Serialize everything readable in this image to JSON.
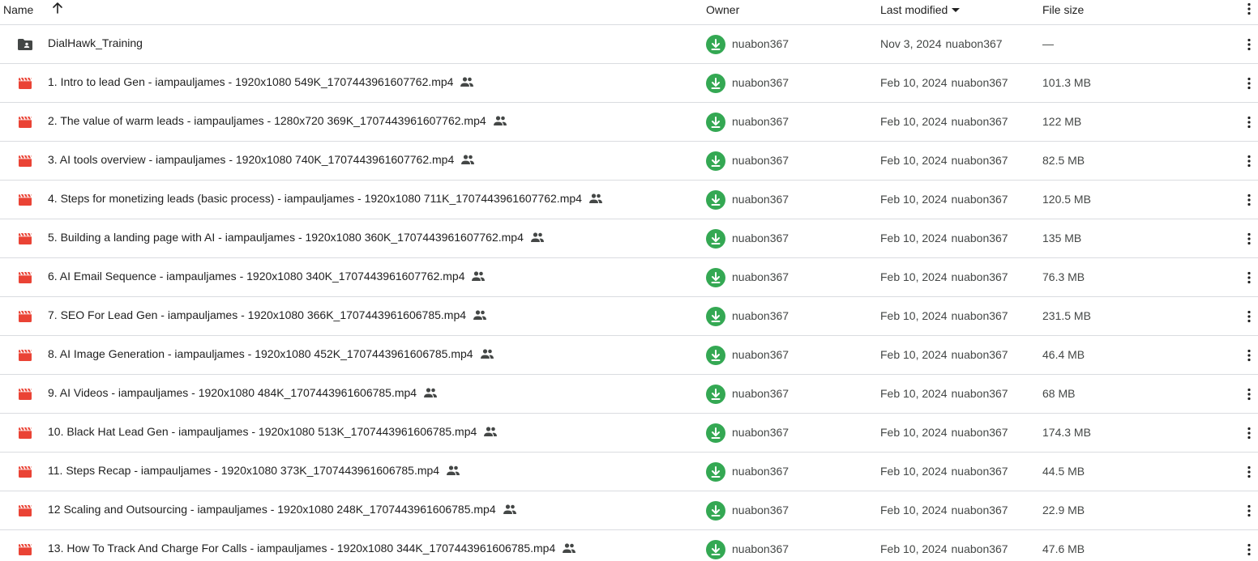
{
  "header": {
    "name_label": "Name",
    "owner_label": "Owner",
    "last_modified_label": "Last modified",
    "file_size_label": "File size"
  },
  "colors": {
    "folder_icon": "#444746",
    "video_icon": "#ea4335",
    "owner_avatar": "#34a853",
    "divider": "#dadce0"
  },
  "files": [
    {
      "type": "folder",
      "icon": "shared-folder-icon",
      "name": "DialHawk_Training",
      "shared": false,
      "owner": "nuabon367",
      "modified_date": "Nov 3, 2024",
      "modified_by": "nuabon367",
      "size": "—"
    },
    {
      "type": "video",
      "icon": "video-file-icon",
      "name": "1. Intro to lead Gen - iampauljames - 1920x1080 549K_1707443961607762.mp4",
      "shared": true,
      "owner": "nuabon367",
      "modified_date": "Feb 10, 2024",
      "modified_by": "nuabon367",
      "size": "101.3 MB"
    },
    {
      "type": "video",
      "icon": "video-file-icon",
      "name": "2. The value of warm leads - iampauljames - 1280x720 369K_1707443961607762.mp4",
      "shared": true,
      "owner": "nuabon367",
      "modified_date": "Feb 10, 2024",
      "modified_by": "nuabon367",
      "size": "122 MB"
    },
    {
      "type": "video",
      "icon": "video-file-icon",
      "name": "3. AI tools overview - iampauljames - 1920x1080 740K_1707443961607762.mp4",
      "shared": true,
      "owner": "nuabon367",
      "modified_date": "Feb 10, 2024",
      "modified_by": "nuabon367",
      "size": "82.5 MB"
    },
    {
      "type": "video",
      "icon": "video-file-icon",
      "name": "4. Steps for monetizing leads (basic process) - iampauljames - 1920x1080 711K_1707443961607762.mp4",
      "shared": true,
      "owner": "nuabon367",
      "modified_date": "Feb 10, 2024",
      "modified_by": "nuabon367",
      "size": "120.5 MB"
    },
    {
      "type": "video",
      "icon": "video-file-icon",
      "name": "5. Building a landing page with AI - iampauljames - 1920x1080 360K_1707443961607762.mp4",
      "shared": true,
      "owner": "nuabon367",
      "modified_date": "Feb 10, 2024",
      "modified_by": "nuabon367",
      "size": "135 MB"
    },
    {
      "type": "video",
      "icon": "video-file-icon",
      "name": "6. AI Email Sequence - iampauljames - 1920x1080 340K_1707443961607762.mp4",
      "shared": true,
      "owner": "nuabon367",
      "modified_date": "Feb 10, 2024",
      "modified_by": "nuabon367",
      "size": "76.3 MB"
    },
    {
      "type": "video",
      "icon": "video-file-icon",
      "name": "7. SEO For Lead Gen - iampauljames - 1920x1080 366K_1707443961606785.mp4",
      "shared": true,
      "owner": "nuabon367",
      "modified_date": "Feb 10, 2024",
      "modified_by": "nuabon367",
      "size": "231.5 MB"
    },
    {
      "type": "video",
      "icon": "video-file-icon",
      "name": "8. AI Image Generation - iampauljames - 1920x1080 452K_1707443961606785.mp4",
      "shared": true,
      "owner": "nuabon367",
      "modified_date": "Feb 10, 2024",
      "modified_by": "nuabon367",
      "size": "46.4 MB"
    },
    {
      "type": "video",
      "icon": "video-file-icon",
      "name": "9. AI Videos - iampauljames - 1920x1080 484K_1707443961606785.mp4",
      "shared": true,
      "owner": "nuabon367",
      "modified_date": "Feb 10, 2024",
      "modified_by": "nuabon367",
      "size": "68 MB"
    },
    {
      "type": "video",
      "icon": "video-file-icon",
      "name": "10. Black Hat Lead Gen - iampauljames - 1920x1080 513K_1707443961606785.mp4",
      "shared": true,
      "owner": "nuabon367",
      "modified_date": "Feb 10, 2024",
      "modified_by": "nuabon367",
      "size": "174.3 MB"
    },
    {
      "type": "video",
      "icon": "video-file-icon",
      "name": "11. Steps Recap - iampauljames - 1920x1080 373K_1707443961606785.mp4",
      "shared": true,
      "owner": "nuabon367",
      "modified_date": "Feb 10, 2024",
      "modified_by": "nuabon367",
      "size": "44.5 MB"
    },
    {
      "type": "video",
      "icon": "video-file-icon",
      "name": "12 Scaling and Outsourcing - iampauljames - 1920x1080 248K_1707443961606785.mp4",
      "shared": true,
      "owner": "nuabon367",
      "modified_date": "Feb 10, 2024",
      "modified_by": "nuabon367",
      "size": "22.9 MB"
    },
    {
      "type": "video",
      "icon": "video-file-icon",
      "name": "13. How To Track And Charge For Calls - iampauljames - 1920x1080 344K_1707443961606785.mp4",
      "shared": true,
      "owner": "nuabon367",
      "modified_date": "Feb 10, 2024",
      "modified_by": "nuabon367",
      "size": "47.6 MB"
    }
  ]
}
